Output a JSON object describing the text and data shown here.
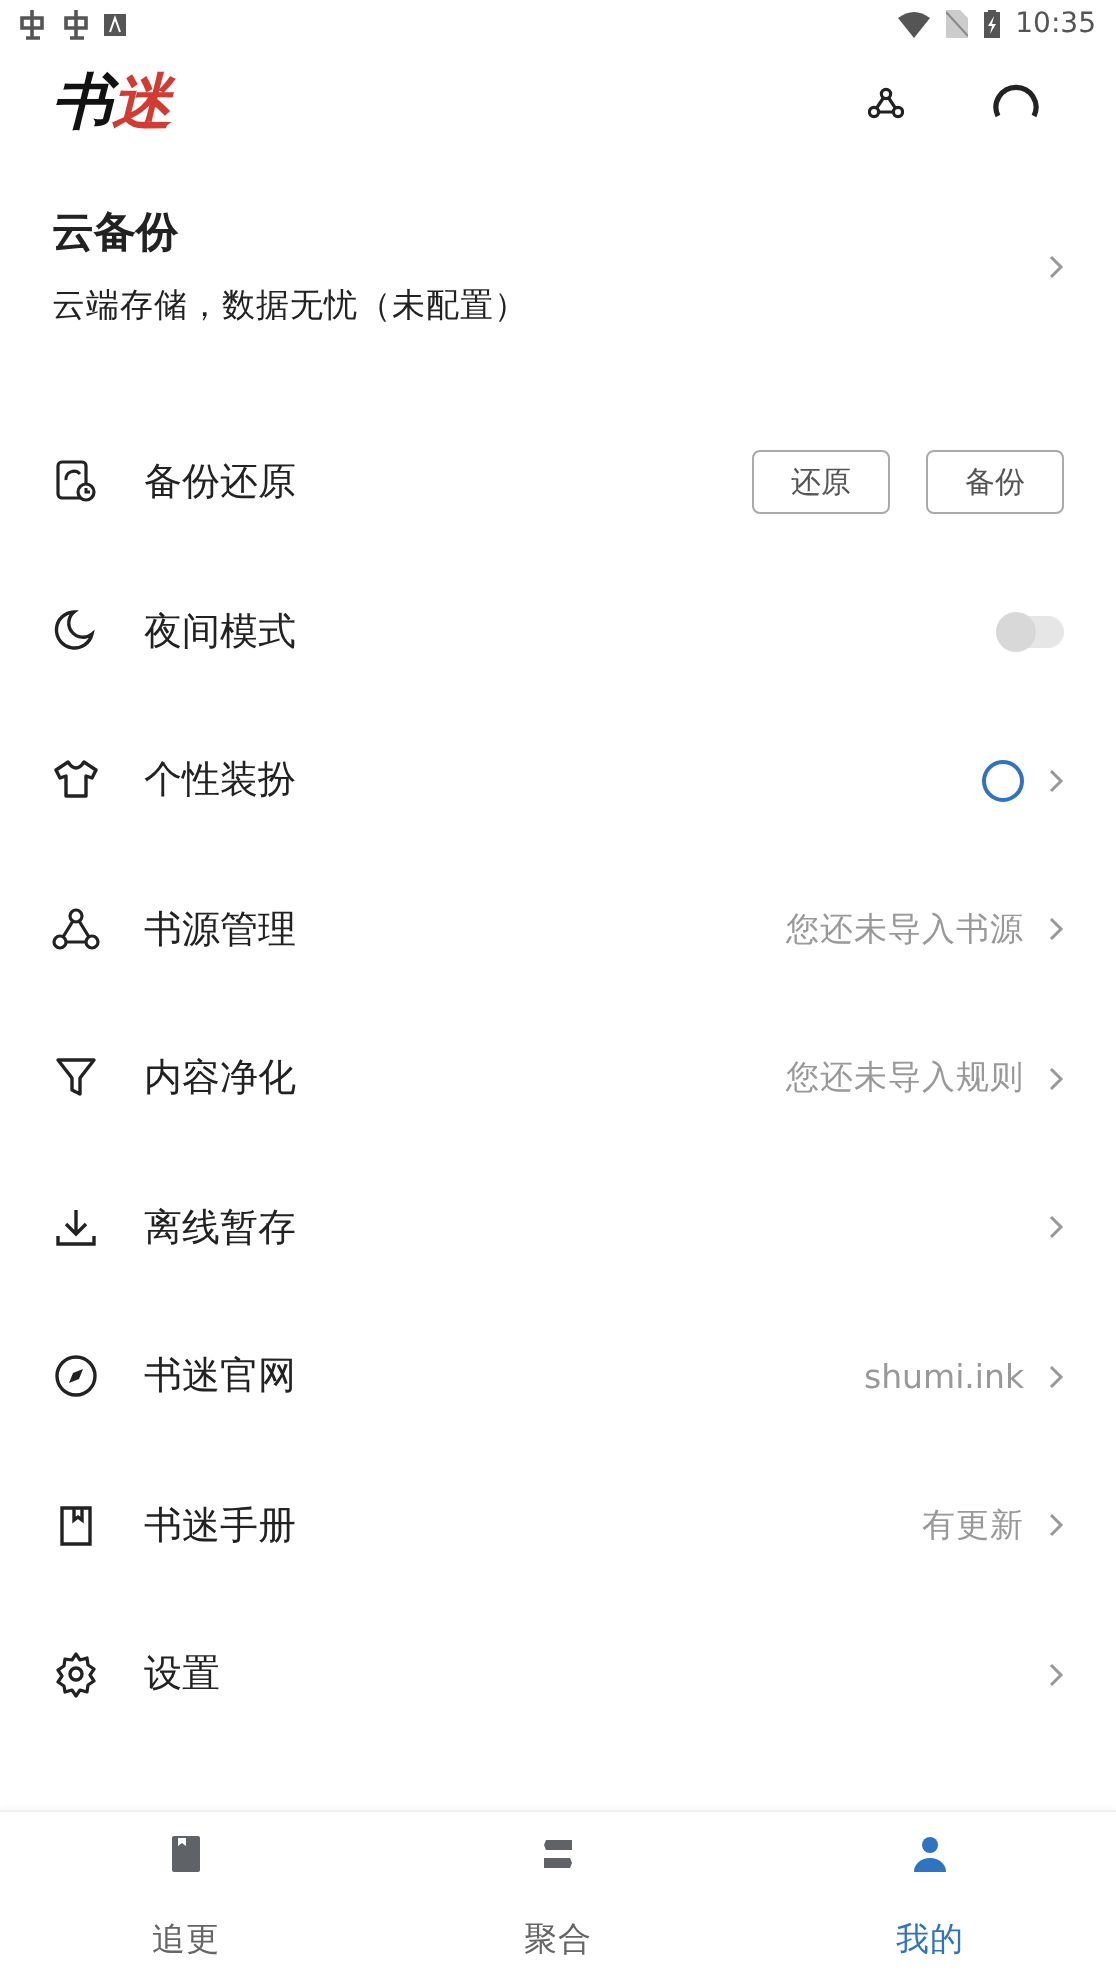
{
  "status_bar": {
    "time": "10:35"
  },
  "header": {
    "logo": "书迷"
  },
  "cloud_backup": {
    "title": "云备份",
    "subtitle": "云端存储，数据无忧（未配置）"
  },
  "settings": [
    {
      "kind": "buttons",
      "label": "备份还原",
      "buttons": [
        "还原",
        "备份"
      ]
    },
    {
      "kind": "toggle",
      "label": "夜间模式",
      "on": false
    },
    {
      "kind": "theme",
      "label": "个性装扮",
      "color": "#2f73c3"
    },
    {
      "kind": "value",
      "label": "书源管理",
      "value": "您还未导入书源"
    },
    {
      "kind": "value",
      "label": "内容净化",
      "value": "您还未导入规则"
    },
    {
      "kind": "link",
      "label": "离线暂存"
    },
    {
      "kind": "value",
      "label": "书迷官网",
      "value": "shumi.ink"
    },
    {
      "kind": "value",
      "label": "书迷手册",
      "value": "有更新"
    },
    {
      "kind": "link",
      "label": "设置"
    }
  ],
  "bottom_nav": [
    {
      "label": "追更",
      "selected": false
    },
    {
      "label": "聚合",
      "selected": false
    },
    {
      "label": "我的",
      "selected": true
    }
  ]
}
